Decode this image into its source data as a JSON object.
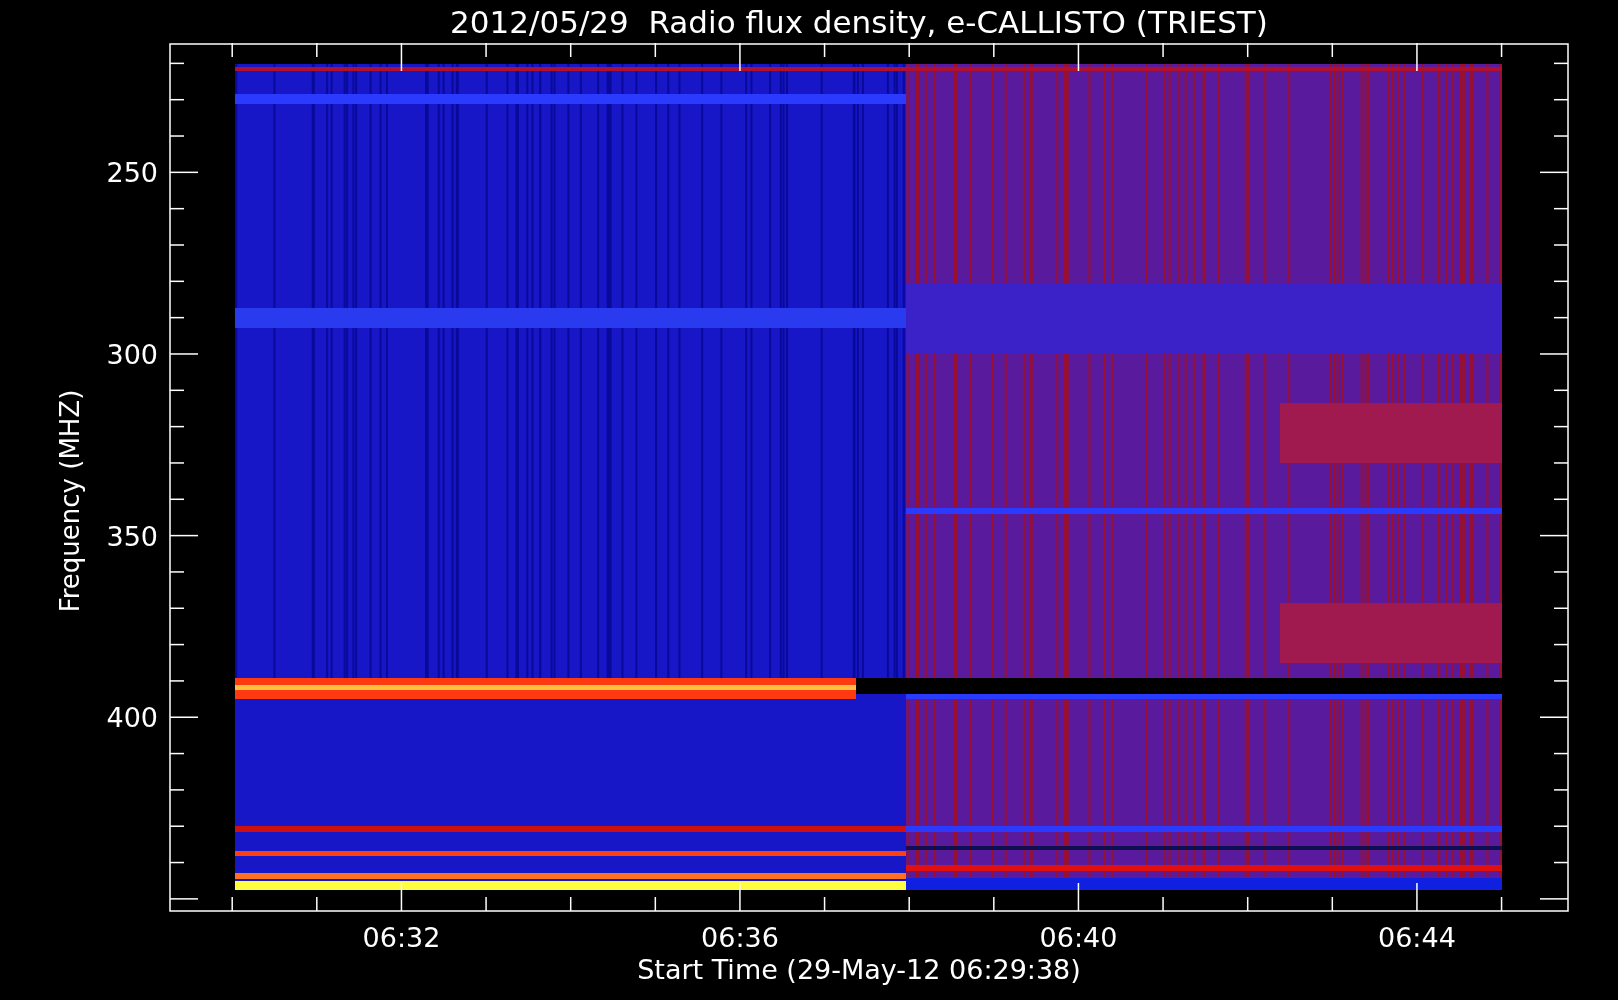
{
  "title": "2012/05/29  Radio flux density, e-CALLISTO (TRIEST)",
  "plot": {
    "y_axis_label": "Frequency (MHZ)",
    "y_tick_labels": [
      "250",
      "300",
      "350",
      "400"
    ],
    "x_tick_labels": [
      "06:32",
      "06:36",
      "06:40",
      "06:44"
    ],
    "x_axis_label": "Start Time (29-May-12 06:29:38)"
  }
}
